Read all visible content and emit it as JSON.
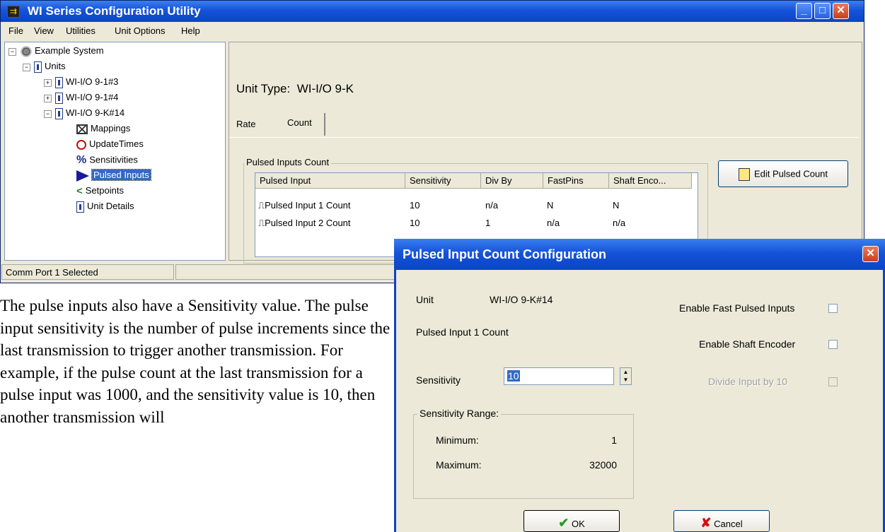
{
  "window": {
    "title": "WI Series Configuration Utility",
    "min_label": "_",
    "max_label": "□",
    "close_label": "✕"
  },
  "menu": [
    "File",
    "View",
    "Utilities",
    "Unit Options",
    "Help"
  ],
  "tree": {
    "root": "Example System",
    "units": "Units",
    "unit1": "WI-I/O 9-1#3",
    "unit2": "WI-I/O 9-1#4",
    "unit3": "WI-I/O 9-K#14",
    "children": [
      "Mappings",
      "UpdateTimes",
      "Sensitivities",
      "Pulsed Inputs",
      "Setpoints",
      "Unit Details"
    ]
  },
  "content": {
    "unit_type_label": "Unit Type:",
    "unit_type_value": "WI-I/O 9-K",
    "tabs": [
      "Rate",
      "Count"
    ],
    "group_label": "Pulsed Inputs Count",
    "edit_button": "Edit Pulsed Count",
    "columns": [
      "Pulsed Input",
      "Sensitivity",
      "Div By",
      "FastPins",
      "Shaft Enco..."
    ],
    "rows": [
      [
        "Pulsed Input 1 Count",
        "10",
        "n/a",
        "N",
        "N"
      ],
      [
        "Pulsed Input 2 Count",
        "10",
        "1",
        "n/a",
        "n/a"
      ]
    ]
  },
  "status": {
    "text": "Comm Port 1 Selected"
  },
  "paragraph": "The pulse inputs also have a Sensitivity value.  The pulse input sensitivity is the number of pulse increments since the last transmission to trigger another transmission.  For example,  if the pulse count at the last transmission for a pulse input was 1000,  and the sensitivity value is 10,  then another transmission will",
  "dialog": {
    "title": "Pulsed Input Count Configuration",
    "unit_label": "Unit",
    "unit_value": "WI-I/O 9-K#14",
    "input_name": "Pulsed Input 1 Count",
    "sensitivity_label": "Sensitivity",
    "sensitivity_value": "10",
    "range_label": "Sensitivity Range:",
    "min_label": "Minimum:",
    "min_value": "1",
    "max_label": "Maximum:",
    "max_value": "32000",
    "enable_fast": "Enable Fast Pulsed Inputs",
    "enable_shaft": "Enable Shaft Encoder",
    "divide": "Divide Input by 10",
    "ok": "OK",
    "cancel": "Cancel"
  },
  "colors": {
    "title_blue": "#0b44c6",
    "selection": "#316ac5",
    "ok_check": "#2e9a2e",
    "cancel_x": "#d01010"
  }
}
